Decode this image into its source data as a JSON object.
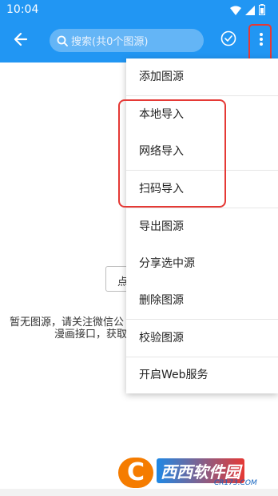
{
  "colors": {
    "primary": "#2196F3",
    "highlight": "#e53935",
    "menu_background": "#ffffff"
  },
  "status_bar": {
    "time": "10:04",
    "icons": [
      "wifi-icon",
      "signal-icon",
      "battery-icon"
    ]
  },
  "app_bar": {
    "back_icon": "arrow-left-icon",
    "search_icon": "search-icon",
    "search_placeholder": "搜索(共0个图源)",
    "check_icon": "check-circle-icon",
    "more_icon": "more-vert-icon"
  },
  "empty_state": {
    "button_label": "点",
    "message_line1": "暂无图源，请关注微信公",
    "message_line2": "漫画接口，获取"
  },
  "menu": {
    "items": [
      {
        "label": "添加图源"
      },
      {
        "label": "本地导入"
      },
      {
        "label": "网络导入"
      },
      {
        "label": "扫码导入"
      },
      {
        "label": "导出图源"
      },
      {
        "label": "分享选中源"
      },
      {
        "label": "删除图源"
      },
      {
        "label": "校验图源"
      },
      {
        "label": "开启Web服务"
      }
    ]
  },
  "watermark": {
    "badge": "C",
    "title": "西西软件园",
    "subtitle": "CR173.COM"
  }
}
